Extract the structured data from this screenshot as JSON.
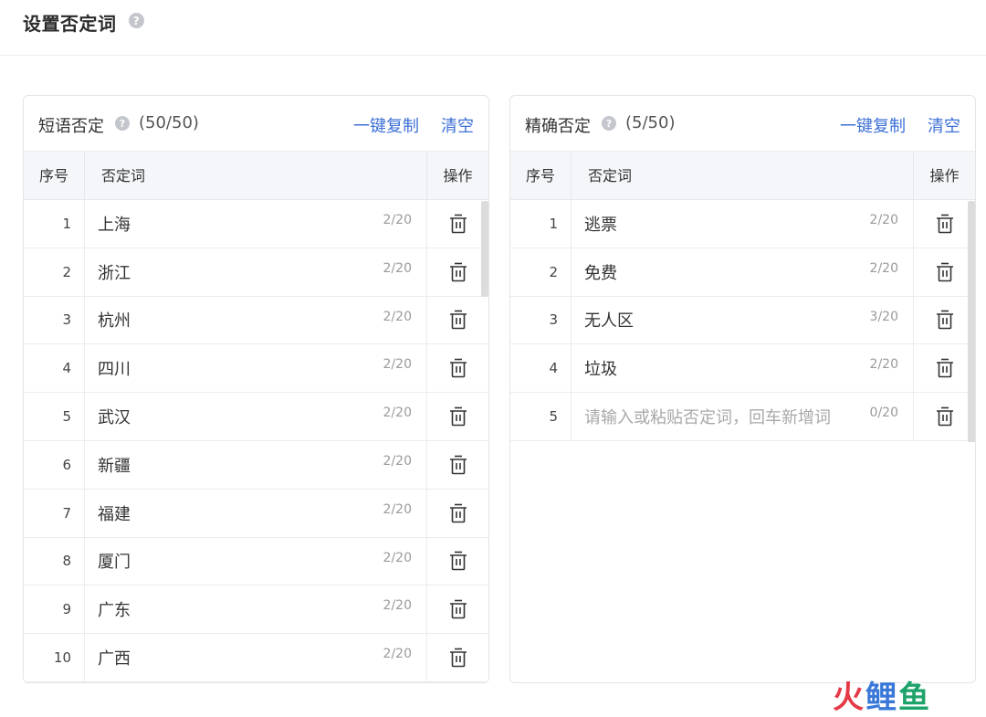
{
  "page": {
    "title": "设置否定词",
    "help": "?"
  },
  "phrase": {
    "title": "短语否定",
    "count": "(50/50)",
    "copy_label": "一键复制",
    "clear_label": "清空",
    "columns": {
      "seq": "序号",
      "word": "否定词",
      "op": "操作"
    },
    "rows": [
      {
        "seq": "1",
        "word": "上海",
        "len": "2/20"
      },
      {
        "seq": "2",
        "word": "浙江",
        "len": "2/20"
      },
      {
        "seq": "3",
        "word": "杭州",
        "len": "2/20"
      },
      {
        "seq": "4",
        "word": "四川",
        "len": "2/20"
      },
      {
        "seq": "5",
        "word": "武汉",
        "len": "2/20"
      },
      {
        "seq": "6",
        "word": "新疆",
        "len": "2/20"
      },
      {
        "seq": "7",
        "word": "福建",
        "len": "2/20"
      },
      {
        "seq": "8",
        "word": "厦门",
        "len": "2/20"
      },
      {
        "seq": "9",
        "word": "广东",
        "len": "2/20"
      },
      {
        "seq": "10",
        "word": "广西",
        "len": "2/20"
      }
    ]
  },
  "exact": {
    "title": "精确否定",
    "count": "(5/50)",
    "copy_label": "一键复制",
    "clear_label": "清空",
    "columns": {
      "seq": "序号",
      "word": "否定词",
      "op": "操作"
    },
    "rows": [
      {
        "seq": "1",
        "word": "逃票",
        "len": "2/20"
      },
      {
        "seq": "2",
        "word": "免费",
        "len": "2/20"
      },
      {
        "seq": "3",
        "word": "无人区",
        "len": "3/20"
      },
      {
        "seq": "4",
        "word": "垃圾",
        "len": "2/20"
      },
      {
        "seq": "5",
        "word": "",
        "placeholder": "请输入或粘贴否定词，回车新增词",
        "len": "0/20"
      }
    ]
  },
  "watermark": {
    "a": "火",
    "b": "鲤",
    "c": "鱼"
  },
  "colors": {
    "link": "#3d6fd6",
    "header_bg": "#f4f6fa",
    "border": "#e5e5e5"
  },
  "icons": {
    "help": "question-circle-icon",
    "delete": "trash-icon"
  }
}
